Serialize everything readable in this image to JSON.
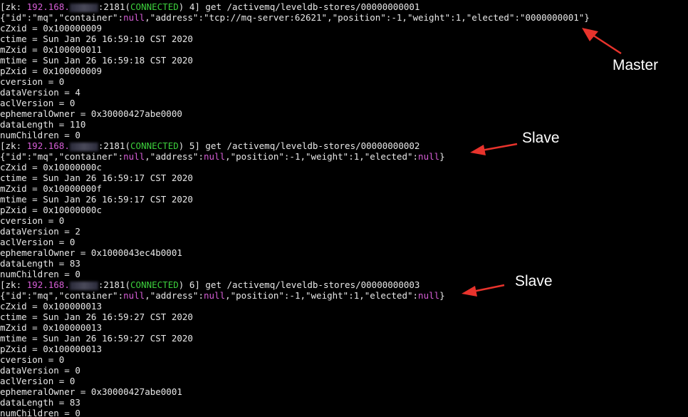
{
  "session": {
    "prompt_open": "[zk: ",
    "ip": "192.168.",
    "port": ":2181(",
    "state": "CONNECTED",
    "prompt_close": ") "
  },
  "blocks": [
    {
      "cmd_num": "4] ",
      "command": "get /activemq/leveldb-stores/00000000001",
      "json": {
        "p1": "{\"id\":\"mq\",\"container\":",
        "null1": "null",
        "p2": ",\"address\":\"tcp://mq-server:62621\",\"position\":-1,\"weight\":1,\"elected\":\"0000000001\"}"
      },
      "stats": [
        "cZxid = 0x100000009",
        "ctime = Sun Jan 26 16:59:10 CST 2020",
        "mZxid = 0x100000011",
        "mtime = Sun Jan 26 16:59:18 CST 2020",
        "pZxid = 0x100000009",
        "cversion = 0",
        "dataVersion = 4",
        "aclVersion = 0",
        "ephemeralOwner = 0x30000427abe0000",
        "dataLength = 110",
        "numChildren = 0"
      ]
    },
    {
      "cmd_num": "5] ",
      "command": "get /activemq/leveldb-stores/00000000002",
      "json": {
        "p1": "{\"id\":\"mq\",\"container\":",
        "null1": "null",
        "p2": ",\"address\":",
        "null2": "null",
        "p3": ",\"position\":-1,\"weight\":1,\"elected\":",
        "null3": "null",
        "p4": "}"
      },
      "stats": [
        "cZxid = 0x10000000c",
        "ctime = Sun Jan 26 16:59:17 CST 2020",
        "mZxid = 0x10000000f",
        "mtime = Sun Jan 26 16:59:17 CST 2020",
        "pZxid = 0x10000000c",
        "cversion = 0",
        "dataVersion = 2",
        "aclVersion = 0",
        "ephemeralOwner = 0x1000043ec4b0001",
        "dataLength = 83",
        "numChildren = 0"
      ]
    },
    {
      "cmd_num": "6] ",
      "command": "get /activemq/leveldb-stores/00000000003",
      "json": {
        "p1": "{\"id\":\"mq\",\"container\":",
        "null1": "null",
        "p2": ",\"address\":",
        "null2": "null",
        "p3": ",\"position\":-1,\"weight\":1,\"elected\":",
        "null3": "null",
        "p4": "}"
      },
      "stats": [
        "cZxid = 0x100000013",
        "ctime = Sun Jan 26 16:59:27 CST 2020",
        "mZxid = 0x100000013",
        "mtime = Sun Jan 26 16:59:27 CST 2020",
        "pZxid = 0x100000013",
        "cversion = 0",
        "dataVersion = 0",
        "aclVersion = 0",
        "ephemeralOwner = 0x30000427abe0001",
        "dataLength = 83",
        "numChildren = 0"
      ]
    }
  ],
  "annotations": {
    "master": "Master",
    "slave1": "Slave",
    "slave2": "Slave",
    "arrow_color": "#e8332c"
  },
  "colors": {
    "background": "#000000",
    "text": "#e8e8e8",
    "ip": "#d65ed6",
    "connected": "#3ccf3c",
    "null": "#d65ed6"
  }
}
